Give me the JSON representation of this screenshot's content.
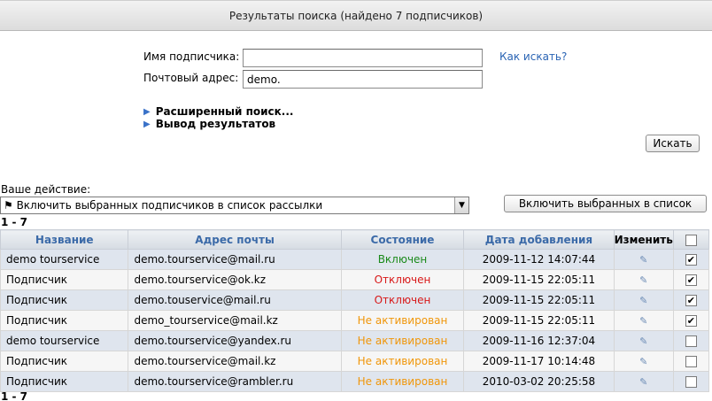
{
  "header": {
    "title": "Результаты поиска (найдено 7 подписчиков)"
  },
  "form": {
    "name_label": "Имя подписчика:",
    "name_value": "",
    "email_label": "Почтовый адрес:",
    "email_value": "demo.",
    "how_link": "Как искать?",
    "advanced": "Расширенный поиск...",
    "output": "Вывод результатов",
    "search_button": "Искать"
  },
  "action": {
    "label": "Ваше действие:",
    "selected": "⚑ Включить выбранных подписчиков в список рассылки",
    "button": "Включить выбранных в список"
  },
  "range_top": "1 - 7",
  "range_bottom": "1 - 7",
  "table": {
    "headers": [
      "Название",
      "Адрес почты",
      "Состояние",
      "Дата добавления",
      "Изменить"
    ],
    "rows": [
      {
        "name": "demo tourservice",
        "email": "demo.tourservice@mail.ru",
        "status": "Включен",
        "date": "2009-11-12 14:07:44",
        "checked": "✔"
      },
      {
        "name": "Подписчик",
        "email": "demo.tourservice@ok.kz",
        "status": "Отключен",
        "date": "2009-11-15 22:05:11",
        "checked": "✔"
      },
      {
        "name": "Подписчик",
        "email": "demo.touservice@mail.ru",
        "status": "Отключен",
        "date": "2009-11-15 22:05:11",
        "checked": "✔"
      },
      {
        "name": "Подписчик",
        "email": "demo_tourservice@mail.kz",
        "status": "Не активирован",
        "date": "2009-11-15 22:05:11",
        "checked": "✔"
      },
      {
        "name": "demo tourservice",
        "email": "demo.tourservice@yandex.ru",
        "status": "Не активирован",
        "date": "2009-11-16 12:37:04",
        "checked": ""
      },
      {
        "name": "Подписчик",
        "email": "demo.tourservice@mail.kz",
        "status": "Не активирован",
        "date": "2009-11-17 10:14:48",
        "checked": ""
      },
      {
        "name": "Подписчик",
        "email": "demo.tourservice@rambler.ru",
        "status": "Не активирован",
        "date": "2010-03-02 20:25:58",
        "checked": ""
      }
    ]
  },
  "colors": {
    "link": "#2a64b4",
    "on": "#1a8a1a",
    "off": "#d81818",
    "inactive": "#f0960a"
  },
  "icons": {
    "edit": "pencil-icon",
    "expand": "triangle-right-icon",
    "flag": "flag-icon"
  }
}
